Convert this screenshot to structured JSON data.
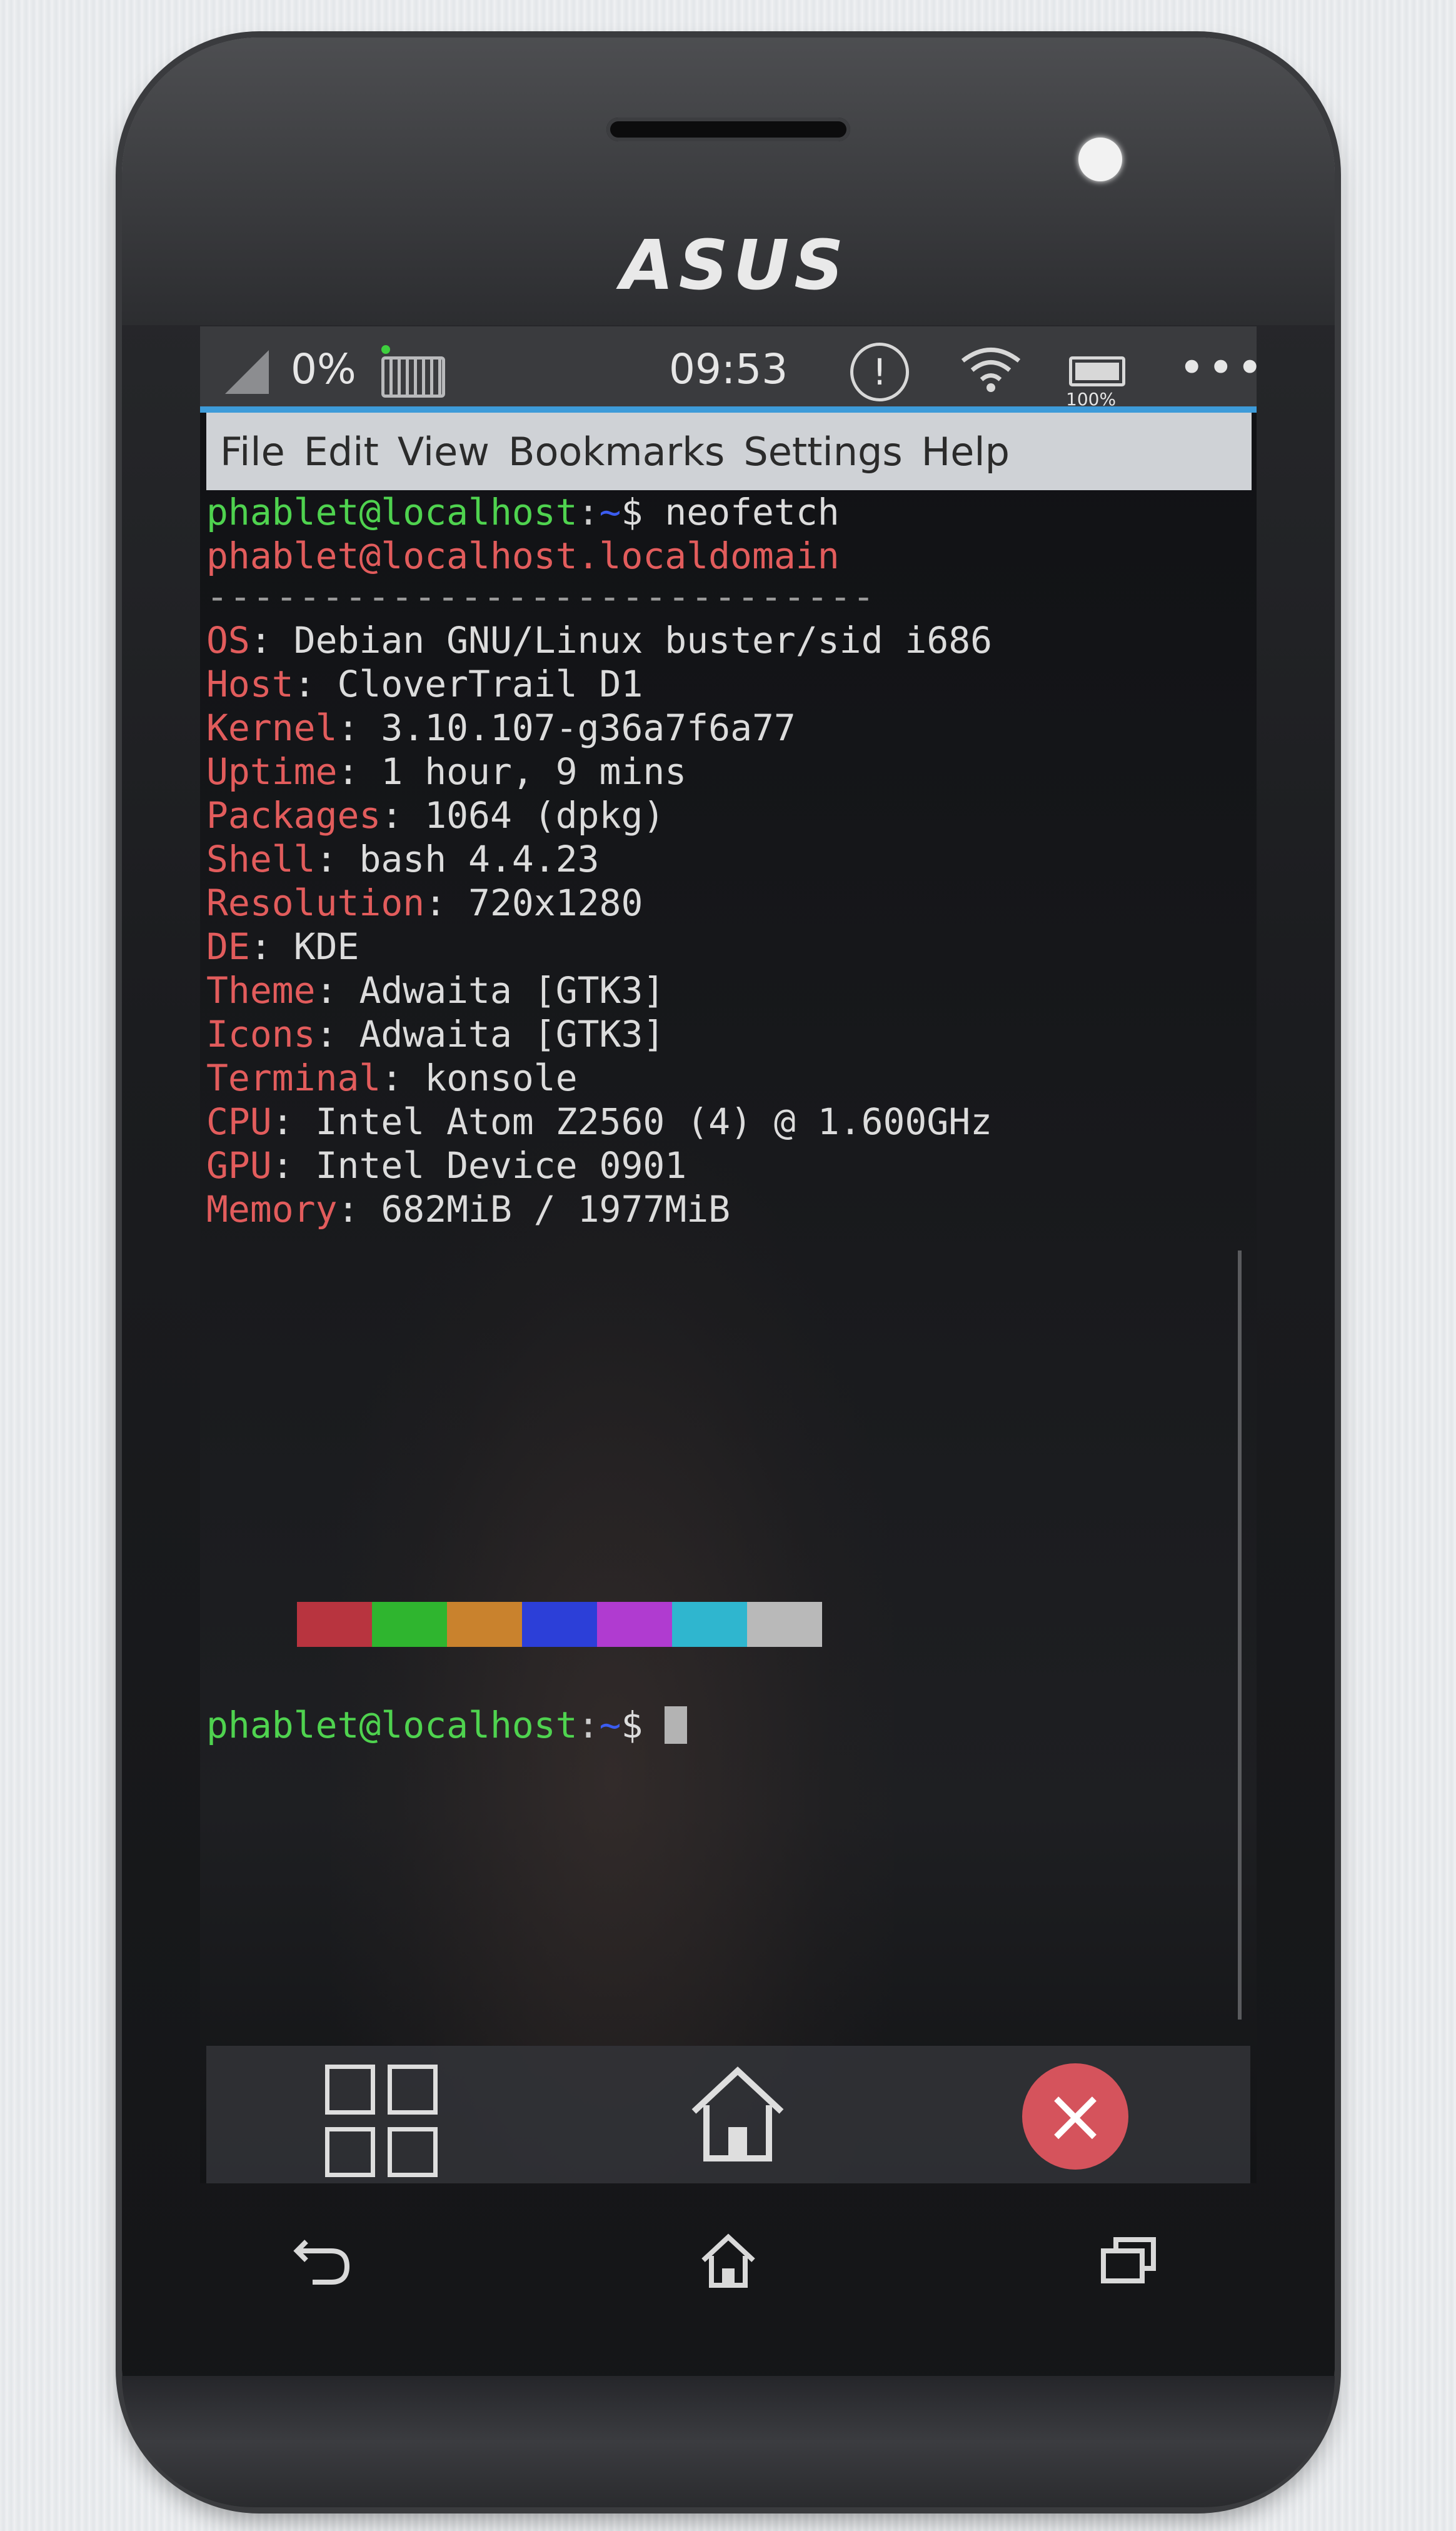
{
  "device": {
    "brand": "ASUS"
  },
  "status_bar": {
    "battery_percent": "0%",
    "time": "09:53",
    "alert_glyph": "!",
    "battery_label": "100%",
    "battery_level": 1.0,
    "overflow_glyph": "•••"
  },
  "menu": [
    "File",
    "Edit",
    "View",
    "Bookmarks",
    "Settings",
    "Help"
  ],
  "terminal": {
    "prompt_user": "phablet@localhost",
    "prompt_path": "~",
    "prompt_symbol": "$ ",
    "command": "neofetch",
    "title": "phablet@localhost.localdomain",
    "separator": "-----------------------------",
    "info": [
      {
        "key": "OS",
        "value": "Debian GNU/Linux buster/sid i686"
      },
      {
        "key": "Host",
        "value": "CloverTrail D1"
      },
      {
        "key": "Kernel",
        "value": "3.10.107-g36a7f6a77"
      },
      {
        "key": "Uptime",
        "value": "1 hour, 9 mins"
      },
      {
        "key": "Packages",
        "value": "1064 (dpkg)"
      },
      {
        "key": "Shell",
        "value": "bash 4.4.23"
      },
      {
        "key": "Resolution",
        "value": "720x1280"
      },
      {
        "key": "DE",
        "value": "KDE"
      },
      {
        "key": "Theme",
        "value": "Adwaita [GTK3]"
      },
      {
        "key": "Icons",
        "value": "Adwaita [GTK3]"
      },
      {
        "key": "Terminal",
        "value": "konsole"
      },
      {
        "key": "CPU",
        "value": "Intel Atom Z2560 (4) @ 1.600GHz"
      },
      {
        "key": "GPU",
        "value": "Intel Device 0901"
      },
      {
        "key": "Memory",
        "value": "682MiB / 1977MiB"
      }
    ],
    "palette": [
      "#b8343f",
      "#2fb52f",
      "#c9822d",
      "#2c3fd8",
      "#b03bd0",
      "#2fb6cf",
      "#b9b9b9"
    ]
  },
  "dock": {
    "close_glyph": "×"
  },
  "icons": {
    "signal": "signal-icon",
    "keyboard": "keyboard-icon",
    "alert": "alert-icon",
    "wifi": "wifi-icon",
    "battery": "battery-icon",
    "overflow": "more-icon",
    "apps": "app-grid-icon",
    "home": "home-icon",
    "close": "close-icon",
    "back": "back-icon",
    "nav_home": "nav-home-icon",
    "recents": "recents-icon"
  },
  "colors": {
    "prompt": "#4fd34f",
    "path": "#3b5cf0",
    "key": "#e25c5c",
    "menubar": "#cfd2d6",
    "accent_line": "#3d9bd9",
    "close_button": "#d5535c"
  }
}
